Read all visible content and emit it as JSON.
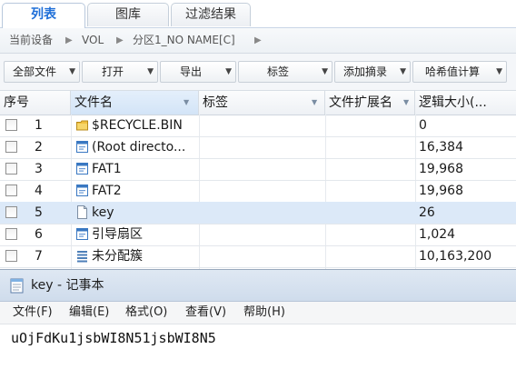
{
  "tabs": [
    {
      "label": "列表",
      "active": true
    },
    {
      "label": "图库",
      "active": false
    },
    {
      "label": "过滤结果",
      "active": false
    }
  ],
  "breadcrumb": [
    "当前设备",
    "VOL",
    "分区1_NO NAME[C]"
  ],
  "toolbar": [
    {
      "label": "全部文件"
    },
    {
      "label": "打开"
    },
    {
      "label": "导出"
    },
    {
      "label": "标签"
    },
    {
      "label": "添加摘录"
    },
    {
      "label": "哈希值计算"
    }
  ],
  "columns": {
    "index": "序号",
    "name": "文件名",
    "tag": "标签",
    "ext": "文件扩展名",
    "size": "逻辑大小(..."
  },
  "rows": [
    {
      "index": "1",
      "name": "$RECYCLE.BIN",
      "size": "0",
      "icon": "folder-icon",
      "selected": false
    },
    {
      "index": "2",
      "name": "(Root directo...",
      "size": "16,384",
      "icon": "system-file-icon",
      "selected": false
    },
    {
      "index": "3",
      "name": "FAT1",
      "size": "19,968",
      "icon": "system-file-icon",
      "selected": false
    },
    {
      "index": "4",
      "name": "FAT2",
      "size": "19,968",
      "icon": "system-file-icon",
      "selected": false
    },
    {
      "index": "5",
      "name": "key",
      "size": "26",
      "icon": "document-icon",
      "selected": true
    },
    {
      "index": "6",
      "name": "引导扇区",
      "size": "1,024",
      "icon": "system-file-icon",
      "selected": false
    },
    {
      "index": "7",
      "name": "未分配簇",
      "size": "10,163,200",
      "icon": "unallocated-icon",
      "selected": false
    }
  ],
  "notepad": {
    "title": "key - 记事本",
    "menu": [
      "文件(F)",
      "编辑(E)",
      "格式(O)",
      "查看(V)",
      "帮助(H)"
    ],
    "content": "uOjFdKu1jsbWI8N51jsbWI8N5"
  },
  "colors": {
    "accent": "#1f6fd8",
    "selected_row": "#dce9f8",
    "folder": "#f0c040"
  }
}
